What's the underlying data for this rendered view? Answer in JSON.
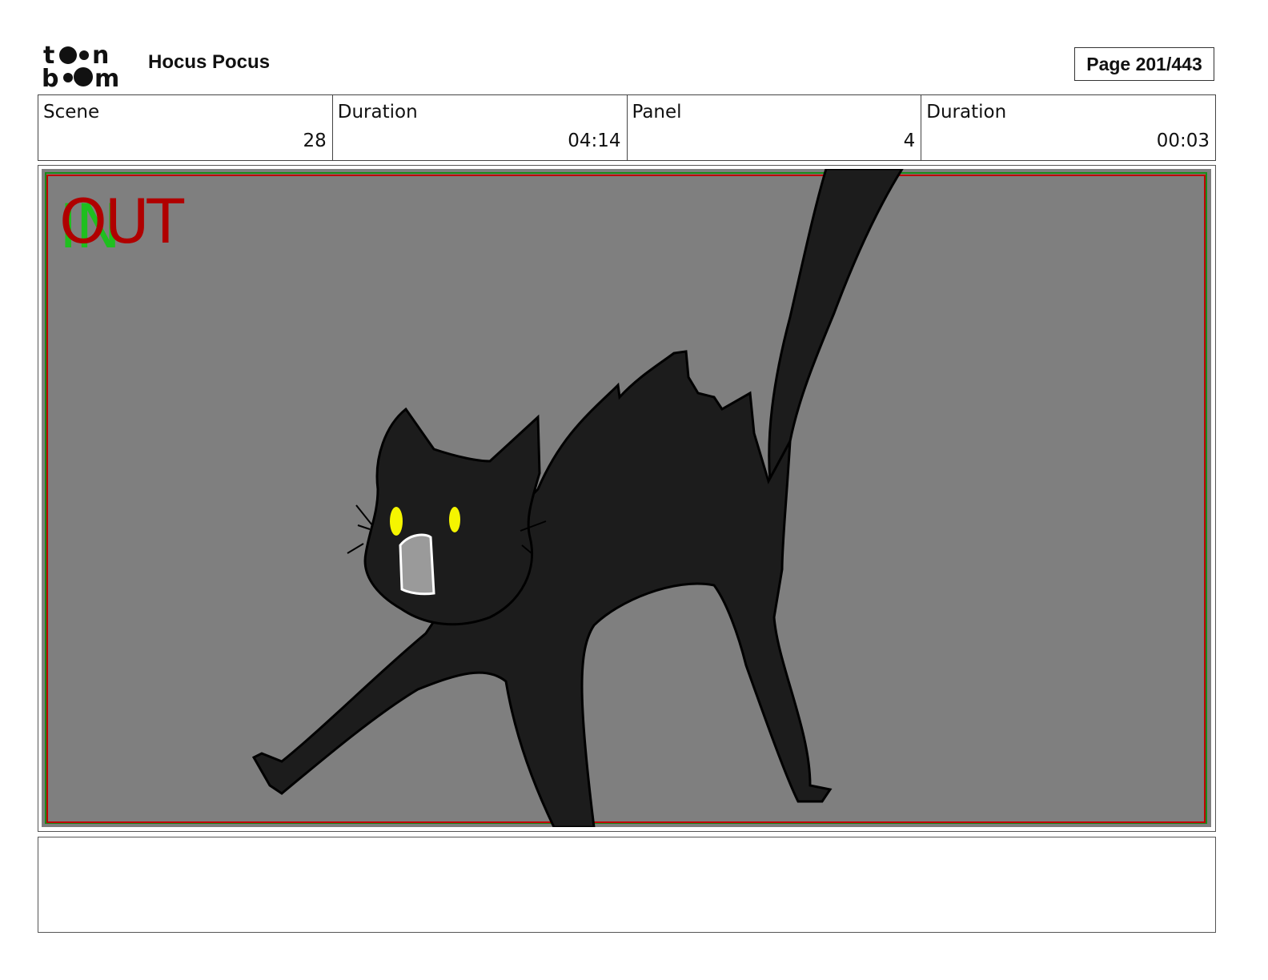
{
  "header": {
    "logo_text": "toon boom",
    "project_title": "Hocus Pocus",
    "page_label": "Page 201/443"
  },
  "info": {
    "scene_label": "Scene",
    "scene_value": "28",
    "scene_duration_label": "Duration",
    "scene_duration_value": "04:14",
    "panel_label": "Panel",
    "panel_value": "4",
    "panel_duration_label": "Duration",
    "panel_duration_value": "00:03"
  },
  "panel": {
    "in_marker": "IN",
    "out_marker": "OUT",
    "background_color": "#7f7f7f",
    "safe_frame_color": "#c00000",
    "title_safe_color": "#1a8a1a"
  },
  "notes": {
    "text": ""
  }
}
